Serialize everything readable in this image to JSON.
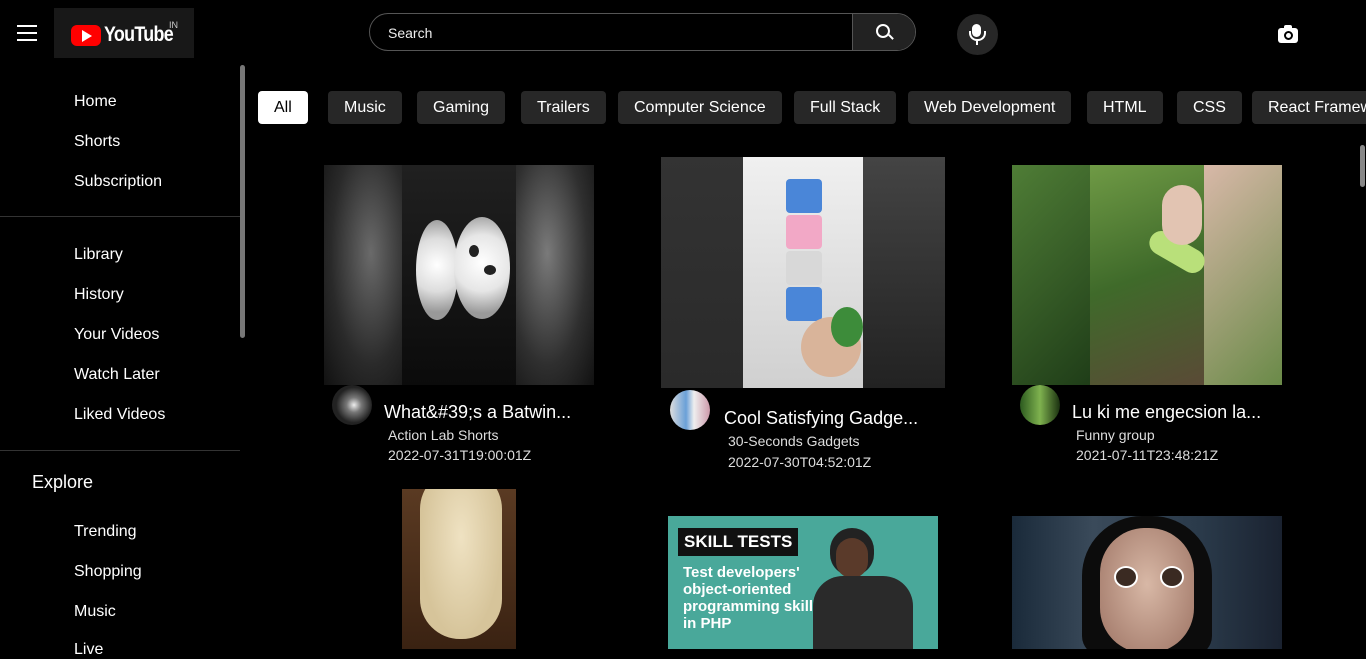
{
  "header": {
    "logo_text": "YouTube",
    "country_code": "IN",
    "search_placeholder": "Search",
    "icons": [
      "menu-icon",
      "search-icon",
      "mic-icon",
      "camera-icon"
    ]
  },
  "sidebar": {
    "group1": [
      "Home",
      "Shorts",
      "Subscription"
    ],
    "group2": [
      "Library",
      "History",
      "Your Videos",
      "Watch Later",
      "Liked Videos"
    ],
    "explore_title": "Explore",
    "group3": [
      "Trending",
      "Shopping",
      "Music",
      "Live"
    ]
  },
  "chips": [
    "All",
    "Music",
    "Gaming",
    "Trailers",
    "Computer Science",
    "Full Stack",
    "Web Development",
    "HTML",
    "CSS",
    "React Framework"
  ],
  "videos": [
    {
      "title": "What&#39;s a Batwin...",
      "channel": "Action Lab Shorts",
      "date": "2022-07-31T19:00:01Z"
    },
    {
      "title": "Cool Satisfying Gadge...",
      "channel": "30-Seconds Gadgets",
      "date": "2022-07-30T04:52:01Z"
    },
    {
      "title": "Lu ki me engecsion la...",
      "channel": "Funny group",
      "date": "2021-07-11T23:48:21Z"
    }
  ],
  "second_row": {
    "thumb2_heading": "SKILL TESTS",
    "thumb2_text": "Test developers' object-oriented programming skills in PHP"
  },
  "colors": {
    "brand_red": "#ff0000",
    "chip_bg": "#272727",
    "background": "#000000",
    "skill_teal": "#49a89a"
  }
}
